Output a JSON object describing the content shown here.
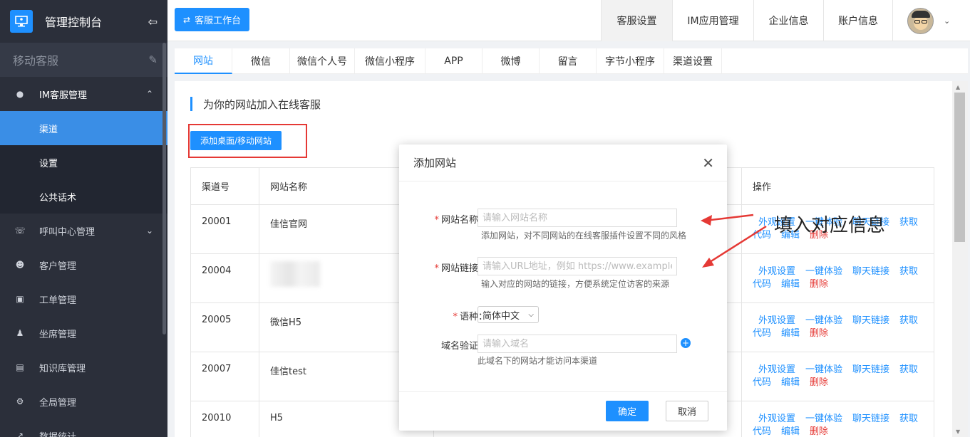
{
  "sidebar": {
    "title": "管理控制台",
    "logo_icon": "monitor-icon",
    "sub_title": "移动客服",
    "groups": [
      {
        "label": "IM客服管理",
        "icon": "chat-icon",
        "open": true,
        "children": [
          {
            "label": "渠道",
            "active": true
          },
          {
            "label": "设置",
            "active": false
          },
          {
            "label": "公共话术",
            "active": false
          }
        ]
      },
      {
        "label": "呼叫中心管理",
        "icon": "phone-icon",
        "has_children": true
      },
      {
        "label": "客户管理",
        "icon": "users-icon"
      },
      {
        "label": "工单管理",
        "icon": "document-icon"
      },
      {
        "label": "坐席管理",
        "icon": "person-icon"
      },
      {
        "label": "知识库管理",
        "icon": "book-icon"
      },
      {
        "label": "全局管理",
        "icon": "gear-icon"
      },
      {
        "label": "数据统计",
        "icon": "chart-icon"
      }
    ]
  },
  "topbar": {
    "workbench_label": "客服工作台",
    "nav": [
      {
        "label": "客服设置",
        "active": true
      },
      {
        "label": "IM应用管理",
        "active": false
      },
      {
        "label": "企业信息",
        "active": false
      },
      {
        "label": "账户信息",
        "active": false
      }
    ]
  },
  "tabs": [
    {
      "label": "网站",
      "active": true
    },
    {
      "label": "微信",
      "active": false
    },
    {
      "label": "微信个人号",
      "active": false
    },
    {
      "label": "微信小程序",
      "active": false
    },
    {
      "label": "APP",
      "active": false
    },
    {
      "label": "微博",
      "active": false
    },
    {
      "label": "留言",
      "active": false
    },
    {
      "label": "字节小程序",
      "active": false
    },
    {
      "label": "渠道设置",
      "active": false
    }
  ],
  "main": {
    "section_title": "为你的网站加入在线客服",
    "add_button": "添加桌面/移动网站",
    "table": {
      "headers": [
        "渠道号",
        "网站名称",
        "",
        "操作"
      ],
      "rows": [
        {
          "id": "20001",
          "name": "佳信官网",
          "ops_line2_first": "代码"
        },
        {
          "id": "20004",
          "name": "",
          "blurred": true,
          "ops_line2_first": "代码"
        },
        {
          "id": "20005",
          "name": "微信H5",
          "ops_line2_first": "代码"
        },
        {
          "id": "20007",
          "name": "佳信test",
          "ops_line2_first": "代码"
        },
        {
          "id": "20010",
          "name": "H5",
          "ops_line2_first": "代码"
        }
      ],
      "ops": {
        "appearance": "外观设置",
        "try": "一键体验",
        "chat_link": "聊天链接",
        "get": "获取",
        "code": "代码",
        "edit": "编辑",
        "delete": "删除"
      }
    }
  },
  "modal": {
    "title": "添加网站",
    "fields": {
      "name": {
        "label": "网站名称：",
        "placeholder": "请输入网站名称",
        "hint": "添加网站，对不同网站的在线客服插件设置不同的风格"
      },
      "url": {
        "label": "网站链接：",
        "placeholder": "请输入URL地址，例如 https://www.example.",
        "hint": "输入对应的网站的链接，方便系统定位访客的来源"
      },
      "lang": {
        "label": "语种：",
        "value": "简体中文"
      },
      "domain": {
        "label": "域名验证：",
        "placeholder": "请输入域名",
        "hint": "此域名下的网站才能访问本渠道"
      }
    },
    "required_mark": "*",
    "ok": "确定",
    "cancel": "取消"
  },
  "annotation": "填入对应信息",
  "colors": {
    "primary": "#1e90ff",
    "danger": "#e53935",
    "sidebar_bg": "#2b2f3a"
  }
}
